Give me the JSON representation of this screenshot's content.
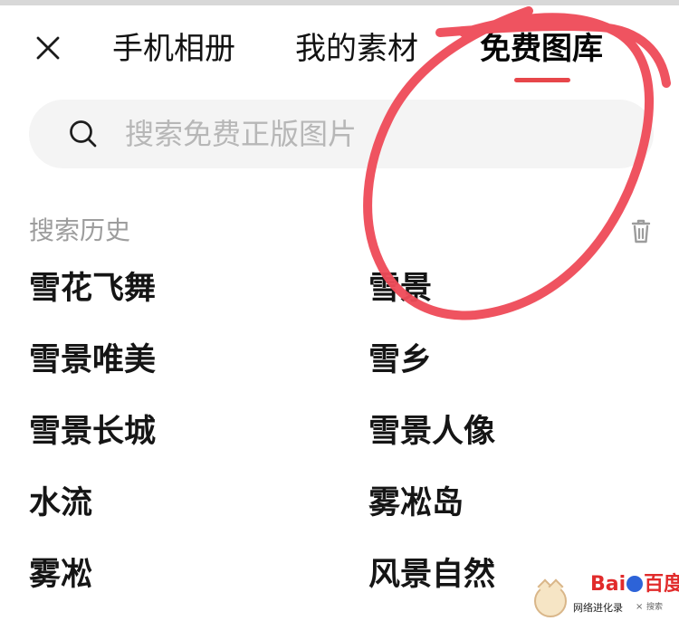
{
  "tabs": {
    "album": "手机相册",
    "materials": "我的素材",
    "gallery": "免费图库"
  },
  "search": {
    "placeholder": "搜索免费正版图片"
  },
  "history": {
    "title": "搜索历史",
    "items": {
      "left": [
        "雪花飞舞",
        "雪景唯美",
        "雪景长城",
        "水流",
        "雾凇"
      ],
      "right": [
        "雪景",
        "雪乡",
        "雪景人像",
        "雾凇岛",
        "风景自然"
      ]
    }
  },
  "icons": {
    "close": "close-icon",
    "search": "search-icon",
    "trash": "trash-icon"
  },
  "colors": {
    "accent": "#e7464a",
    "annotation": "#ee4c5a",
    "search_background": "#f4f4f4",
    "placeholder": "#b7b7b7",
    "history_title": "#9d9d9d"
  },
  "watermark": {
    "brand_left": "Bai",
    "brand_right": "百度",
    "sub": "网络进化录",
    "search": "搜索"
  }
}
